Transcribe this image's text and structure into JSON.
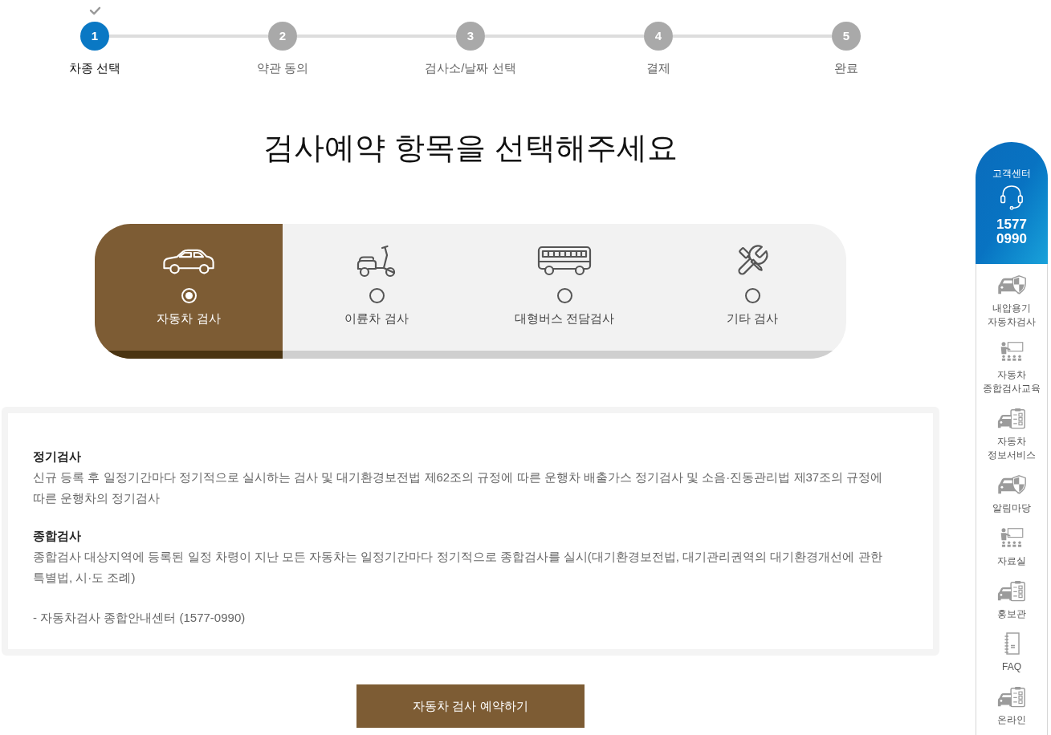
{
  "steps": [
    {
      "number": "1",
      "label": "차종 선택",
      "active": true
    },
    {
      "number": "2",
      "label": "약관 동의",
      "active": false
    },
    {
      "number": "3",
      "label": "검사소/날짜 선택",
      "active": false
    },
    {
      "number": "4",
      "label": "결제",
      "active": false
    },
    {
      "number": "5",
      "label": "완료",
      "active": false
    }
  ],
  "title": "검사예약 항목을 선택해주세요",
  "options": [
    {
      "label": "자동차 검사",
      "selected": true
    },
    {
      "label": "이륜차 검사",
      "selected": false
    },
    {
      "label": "대형버스 전담검사",
      "selected": false
    },
    {
      "label": "기타 검사",
      "selected": false
    }
  ],
  "info": {
    "sections": [
      {
        "heading": "정기검사",
        "text": "신규 등록 후 일정기간마다 정기적으로 실시하는 검사 및 대기환경보전법 제62조의 규정에 따른 운행차 배출가스 정기검사 및 소음·진동관리법 제37조의 규정에 따른 운행차의 정기검사"
      },
      {
        "heading": "종합검사",
        "text": "종합검사 대상지역에 등록된 일정 차령이 지난 모든 자동차는 일정기간마다 정기적으로 종합검사를 실시(대기환경보전법, 대기관리권역의 대기환경개선에 관한 특별법, 시·도 조례)"
      }
    ],
    "contact": "- 자동차검사 종합안내센터 (1577-0990)"
  },
  "reserve_button": "자동차 검사 예약하기",
  "quick_menu": {
    "header": {
      "title": "고객센터",
      "phone": "1577\n0990"
    },
    "items": [
      {
        "label": "내압용기\n자동차검사"
      },
      {
        "label": "자동차\n종합검사교육"
      },
      {
        "label": "자동차\n정보서비스"
      },
      {
        "label": "알림마당"
      },
      {
        "label": "자료실"
      },
      {
        "label": "홍보관"
      },
      {
        "label": "FAQ"
      },
      {
        "label": "온라인"
      }
    ]
  }
}
